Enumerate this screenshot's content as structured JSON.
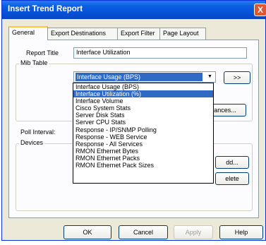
{
  "window": {
    "title": "Insert Trend Report",
    "close_label": "X"
  },
  "tabs": [
    {
      "label": "General",
      "active": true
    },
    {
      "label": "Export Destinations",
      "active": false
    },
    {
      "label": "Export Filter",
      "active": false
    },
    {
      "label": "Page Layout",
      "active": false
    }
  ],
  "general": {
    "report_title_label": "Report Title",
    "report_title_value": "Interface Utilization",
    "mib_table_label": "Mib Table",
    "mib_selected": "Interface Usage (BPS)",
    "more_button": ">>",
    "advanced_button": "ances...",
    "poll_interval_label": "Poll Interval:",
    "devices_label": "Devices",
    "add_button": "dd...",
    "delete_button": "elete"
  },
  "dropdown": {
    "selected_index": 1,
    "options": [
      "Interface Usage (BPS)",
      "Interface Utilization (%)",
      "Interface Volume",
      "Cisco System Stats",
      "Server Disk Stats",
      "Server CPU Stats",
      "Response - IP/SNMP Polling",
      "Response - WEB Service",
      "Response - All Services",
      "RMON Ethernet Bytes",
      "RMON Ethernet Packs",
      "RMON Ethernet Pack Sizes"
    ]
  },
  "footer": {
    "ok": "OK",
    "cancel": "Cancel",
    "apply": "Apply",
    "help": "Help"
  },
  "colors": {
    "title_bar": "#0a5fe0",
    "selection": "#316ac5",
    "dialog_bg": "#ece9d8"
  }
}
